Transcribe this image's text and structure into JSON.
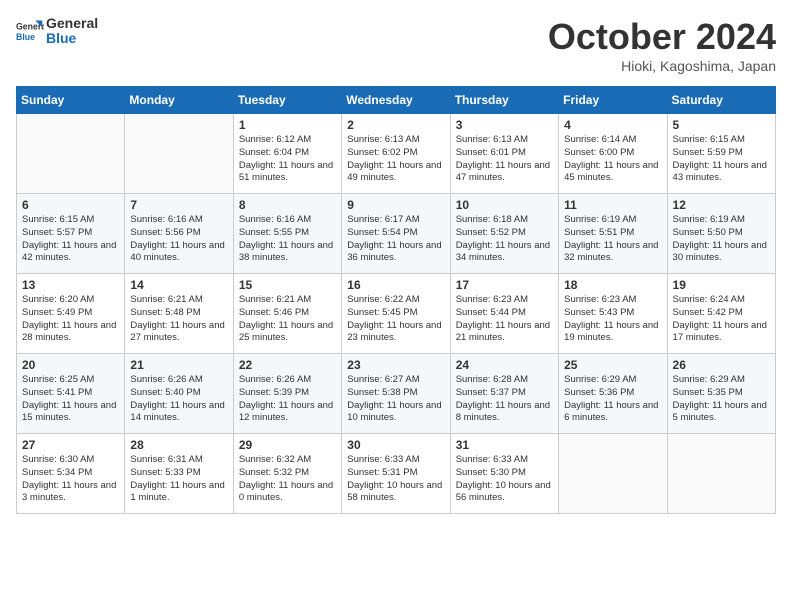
{
  "logo": {
    "line1": "General",
    "line2": "Blue"
  },
  "title": "October 2024",
  "subtitle": "Hioki, Kagoshima, Japan",
  "days_of_week": [
    "Sunday",
    "Monday",
    "Tuesday",
    "Wednesday",
    "Thursday",
    "Friday",
    "Saturday"
  ],
  "weeks": [
    [
      {
        "day": "",
        "content": ""
      },
      {
        "day": "",
        "content": ""
      },
      {
        "day": "1",
        "content": "Sunrise: 6:12 AM\nSunset: 6:04 PM\nDaylight: 11 hours and 51 minutes."
      },
      {
        "day": "2",
        "content": "Sunrise: 6:13 AM\nSunset: 6:02 PM\nDaylight: 11 hours and 49 minutes."
      },
      {
        "day": "3",
        "content": "Sunrise: 6:13 AM\nSunset: 6:01 PM\nDaylight: 11 hours and 47 minutes."
      },
      {
        "day": "4",
        "content": "Sunrise: 6:14 AM\nSunset: 6:00 PM\nDaylight: 11 hours and 45 minutes."
      },
      {
        "day": "5",
        "content": "Sunrise: 6:15 AM\nSunset: 5:59 PM\nDaylight: 11 hours and 43 minutes."
      }
    ],
    [
      {
        "day": "6",
        "content": "Sunrise: 6:15 AM\nSunset: 5:57 PM\nDaylight: 11 hours and 42 minutes."
      },
      {
        "day": "7",
        "content": "Sunrise: 6:16 AM\nSunset: 5:56 PM\nDaylight: 11 hours and 40 minutes."
      },
      {
        "day": "8",
        "content": "Sunrise: 6:16 AM\nSunset: 5:55 PM\nDaylight: 11 hours and 38 minutes."
      },
      {
        "day": "9",
        "content": "Sunrise: 6:17 AM\nSunset: 5:54 PM\nDaylight: 11 hours and 36 minutes."
      },
      {
        "day": "10",
        "content": "Sunrise: 6:18 AM\nSunset: 5:52 PM\nDaylight: 11 hours and 34 minutes."
      },
      {
        "day": "11",
        "content": "Sunrise: 6:19 AM\nSunset: 5:51 PM\nDaylight: 11 hours and 32 minutes."
      },
      {
        "day": "12",
        "content": "Sunrise: 6:19 AM\nSunset: 5:50 PM\nDaylight: 11 hours and 30 minutes."
      }
    ],
    [
      {
        "day": "13",
        "content": "Sunrise: 6:20 AM\nSunset: 5:49 PM\nDaylight: 11 hours and 28 minutes."
      },
      {
        "day": "14",
        "content": "Sunrise: 6:21 AM\nSunset: 5:48 PM\nDaylight: 11 hours and 27 minutes."
      },
      {
        "day": "15",
        "content": "Sunrise: 6:21 AM\nSunset: 5:46 PM\nDaylight: 11 hours and 25 minutes."
      },
      {
        "day": "16",
        "content": "Sunrise: 6:22 AM\nSunset: 5:45 PM\nDaylight: 11 hours and 23 minutes."
      },
      {
        "day": "17",
        "content": "Sunrise: 6:23 AM\nSunset: 5:44 PM\nDaylight: 11 hours and 21 minutes."
      },
      {
        "day": "18",
        "content": "Sunrise: 6:23 AM\nSunset: 5:43 PM\nDaylight: 11 hours and 19 minutes."
      },
      {
        "day": "19",
        "content": "Sunrise: 6:24 AM\nSunset: 5:42 PM\nDaylight: 11 hours and 17 minutes."
      }
    ],
    [
      {
        "day": "20",
        "content": "Sunrise: 6:25 AM\nSunset: 5:41 PM\nDaylight: 11 hours and 15 minutes."
      },
      {
        "day": "21",
        "content": "Sunrise: 6:26 AM\nSunset: 5:40 PM\nDaylight: 11 hours and 14 minutes."
      },
      {
        "day": "22",
        "content": "Sunrise: 6:26 AM\nSunset: 5:39 PM\nDaylight: 11 hours and 12 minutes."
      },
      {
        "day": "23",
        "content": "Sunrise: 6:27 AM\nSunset: 5:38 PM\nDaylight: 11 hours and 10 minutes."
      },
      {
        "day": "24",
        "content": "Sunrise: 6:28 AM\nSunset: 5:37 PM\nDaylight: 11 hours and 8 minutes."
      },
      {
        "day": "25",
        "content": "Sunrise: 6:29 AM\nSunset: 5:36 PM\nDaylight: 11 hours and 6 minutes."
      },
      {
        "day": "26",
        "content": "Sunrise: 6:29 AM\nSunset: 5:35 PM\nDaylight: 11 hours and 5 minutes."
      }
    ],
    [
      {
        "day": "27",
        "content": "Sunrise: 6:30 AM\nSunset: 5:34 PM\nDaylight: 11 hours and 3 minutes."
      },
      {
        "day": "28",
        "content": "Sunrise: 6:31 AM\nSunset: 5:33 PM\nDaylight: 11 hours and 1 minute."
      },
      {
        "day": "29",
        "content": "Sunrise: 6:32 AM\nSunset: 5:32 PM\nDaylight: 11 hours and 0 minutes."
      },
      {
        "day": "30",
        "content": "Sunrise: 6:33 AM\nSunset: 5:31 PM\nDaylight: 10 hours and 58 minutes."
      },
      {
        "day": "31",
        "content": "Sunrise: 6:33 AM\nSunset: 5:30 PM\nDaylight: 10 hours and 56 minutes."
      },
      {
        "day": "",
        "content": ""
      },
      {
        "day": "",
        "content": ""
      }
    ]
  ]
}
